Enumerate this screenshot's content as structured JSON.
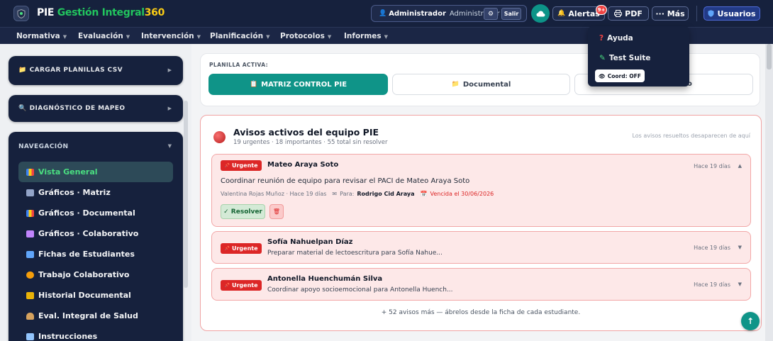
{
  "brand": {
    "part1": "PIE",
    "part2": "Gestión Integral",
    "part3": "360"
  },
  "user": {
    "name": "Administrador",
    "role": "Administrador",
    "settings_icon": "⚙",
    "logout_label": "Salir"
  },
  "header": {
    "alerts_label": "Alertas",
    "alerts_badge": "9+",
    "pdf_label": "PDF",
    "more_label": "··· Más",
    "users_label": "Usuarios"
  },
  "nav": {
    "items": [
      {
        "label": "Normativa"
      },
      {
        "label": "Evaluación"
      },
      {
        "label": "Intervención"
      },
      {
        "label": "Planificación"
      },
      {
        "label": "Protocolos"
      },
      {
        "label": "Informes"
      }
    ]
  },
  "dropdown": {
    "items": [
      {
        "label": "Ayuda"
      },
      {
        "label": "Test Suite"
      }
    ],
    "toggle_label": "Coord: OFF"
  },
  "sidebar": {
    "upload_title": "CARGAR PLANILLAS CSV",
    "mapping_title": "DIAGNÓSTICO DE MAPEO",
    "nav_title": "NAVEGACIÓN",
    "items": [
      {
        "label": "Vista General"
      },
      {
        "label": "Gráficos · Matriz"
      },
      {
        "label": "Gráficos · Documental"
      },
      {
        "label": "Gráficos · Colaborativo"
      },
      {
        "label": "Fichas de Estudiantes"
      },
      {
        "label": "Trabajo Colaborativo"
      },
      {
        "label": "Historial Documental"
      },
      {
        "label": "Eval. Integral de Salud"
      },
      {
        "label": "Instrucciones"
      }
    ]
  },
  "planilla": {
    "label": "PLANILLA ACTIVA:",
    "tabs": [
      {
        "label": "MATRIZ CONTROL PIE"
      },
      {
        "label": "Documental"
      },
      {
        "label": "o"
      }
    ]
  },
  "alerts": {
    "title": "Avisos activos del equipo PIE",
    "subtitle": "19 urgentes · 18 importantes · 55 total sin resolver",
    "note": "Los avisos resueltos desaparecen de aquí",
    "urgent_label": "Urgente",
    "items": [
      {
        "name": "Mateo Araya Soto",
        "time": "Hace 19 días",
        "description": "Coordinar reunión de equipo para revisar el PACI de Mateo Araya Soto",
        "author": "Valentina Rojas Muñoz · Hace 19 días",
        "to_label": "Para:",
        "to_name": "Rodrigo Cid Araya",
        "due": "Vencida el 30/06/2026",
        "resolve_label": "✓ Resolver"
      },
      {
        "name": "Sofía Nahuelpan Díaz",
        "time": "Hace 19 días",
        "description": "Preparar material de lectoescritura para Sofía Nahue..."
      },
      {
        "name": "Antonella Huenchumán Silva",
        "time": "Hace 19 días",
        "description": "Coordinar apoyo socioemocional para Antonella Huench..."
      }
    ],
    "more_note": "+ 52 avisos más — ábrelos desde la ficha de cada estudiante."
  },
  "colors": {
    "navy": "#16213d",
    "teal": "#0f9488",
    "urgent": "#dc2626",
    "brand_green": "#22c55e",
    "brand_yellow": "#facc15"
  }
}
